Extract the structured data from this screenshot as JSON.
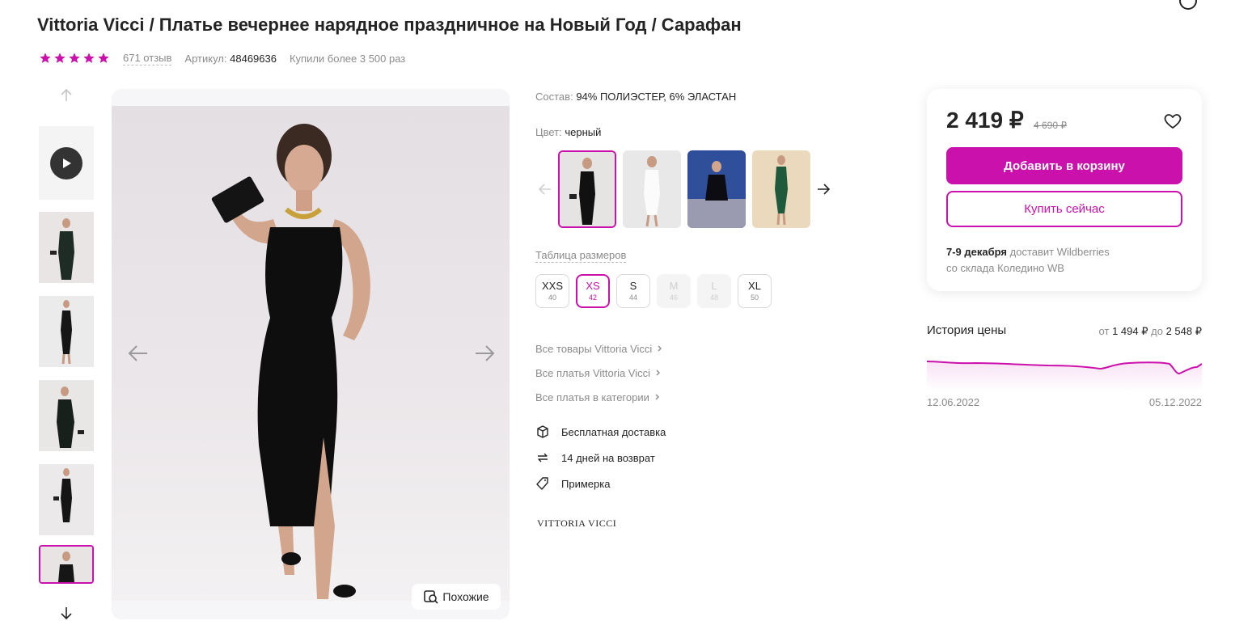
{
  "product": {
    "title": "Vittoria Vicci / Платье вечернее нарядное праздничное на Новый Год / Сарафан",
    "rating_stars": 5,
    "reviews": "671 отзыв",
    "article_label": "Артикул:",
    "article_value": "48469636",
    "bought": "Купили более 3 500 раз"
  },
  "gallery": {
    "similar_label": "Похожие"
  },
  "details": {
    "composition_label": "Состав:",
    "composition_value": "94% ПОЛИЭСТЕР, 6% ЭЛАСТАН",
    "color_label": "Цвет:",
    "color_value": "черный",
    "color_swatches": [
      "black-dress",
      "white-dress",
      "navy-dress",
      "green-dress"
    ],
    "size_table_label": "Таблица размеров",
    "sizes": [
      {
        "size": "XXS",
        "ru": "40",
        "state": "available"
      },
      {
        "size": "XS",
        "ru": "42",
        "state": "selected"
      },
      {
        "size": "S",
        "ru": "44",
        "state": "available"
      },
      {
        "size": "M",
        "ru": "46",
        "state": "disabled"
      },
      {
        "size": "L",
        "ru": "48",
        "state": "disabled"
      },
      {
        "size": "XL",
        "ru": "50",
        "state": "available"
      }
    ],
    "links": [
      "Все товары Vittoria Vicci",
      "Все платья Vittoria Vicci",
      "Все платья в категории"
    ],
    "features": [
      {
        "icon": "box-icon",
        "text": "Бесплатная доставка"
      },
      {
        "icon": "return-icon",
        "text": "14 дней на возврат"
      },
      {
        "icon": "tag-icon",
        "text": "Примерка"
      }
    ],
    "brand_logo": "VITTORIA VICCI"
  },
  "buy_card": {
    "price": "2 419 ₽",
    "old_price": "4 690 ₽",
    "add_to_cart": "Добавить в корзину",
    "buy_now": "Купить сейчас",
    "delivery_date": "7-9 декабря",
    "delivery_by": "доставит Wildberries",
    "delivery_from": "со склада Коледино WB"
  },
  "price_history": {
    "title": "История цены",
    "range_from_label": "от",
    "range_min": "1 494 ₽",
    "range_to_label": "до",
    "range_max": "2 548 ₽",
    "date_start": "12.06.2022",
    "date_end": "05.12.2022"
  },
  "colors": {
    "accent": "#cb11ab",
    "text": "#242424",
    "muted": "#8b8b8b",
    "star": "#cb11ab"
  }
}
